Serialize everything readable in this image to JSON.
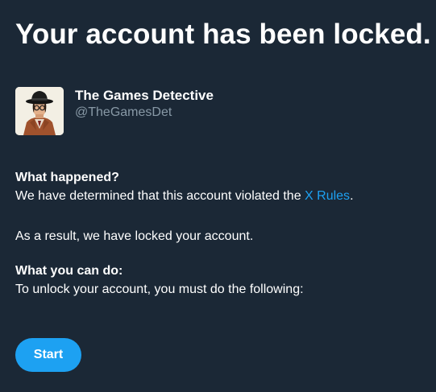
{
  "page": {
    "title": "Your account has been locked."
  },
  "profile": {
    "display_name": "The Games Detective",
    "handle": "@TheGamesDet",
    "avatar_icon": "detective-avatar"
  },
  "what_happened": {
    "heading": "What happened?",
    "text_before_link": "We have determined that this account violated the ",
    "link_label": "X Rules",
    "text_after_link": "."
  },
  "result": {
    "text": "As a result, we have locked your account."
  },
  "what_you_can_do": {
    "heading": "What you can do:",
    "text": "To unlock your account, you must do the following:"
  },
  "actions": {
    "start_label": "Start"
  },
  "colors": {
    "background": "#1b2836",
    "text": "#ffffff",
    "muted": "#8899a6",
    "accent": "#1da1f2"
  }
}
